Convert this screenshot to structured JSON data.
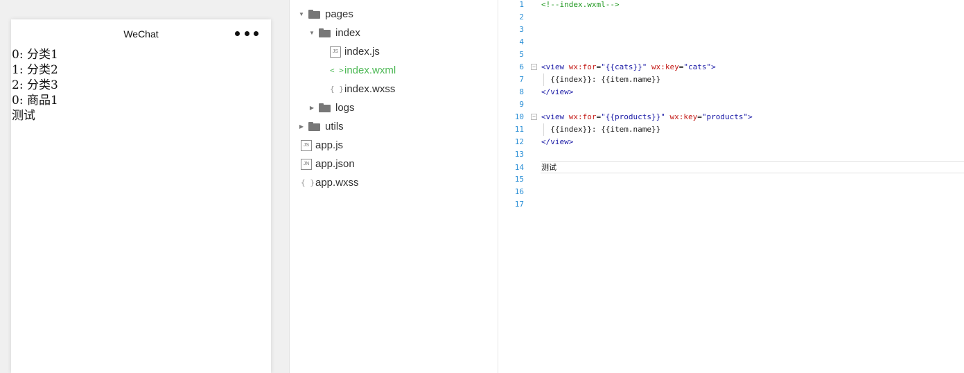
{
  "simulator": {
    "title": "WeChat",
    "lines": [
      "0: 分类1",
      "1: 分类2",
      "2: 分类3",
      "0: 商品1",
      "测试"
    ]
  },
  "file_tree": {
    "items": [
      {
        "label": "pages",
        "type": "folder",
        "expanded": true,
        "icon": "folder-open-icon"
      },
      {
        "label": "index",
        "type": "folder",
        "expanded": true,
        "icon": "folder-open-icon"
      },
      {
        "label": "index.js",
        "type": "file",
        "icon_text": "JS",
        "icon": "js-file-icon"
      },
      {
        "label": "index.wxml",
        "type": "file",
        "icon_text": "< >",
        "icon": "wxml-file-icon",
        "active": true
      },
      {
        "label": "index.wxss",
        "type": "file",
        "icon_text": "{ }",
        "icon": "wxss-file-icon"
      },
      {
        "label": "logs",
        "type": "folder",
        "expanded": false,
        "icon": "folder-icon"
      },
      {
        "label": "utils",
        "type": "folder",
        "expanded": false,
        "icon": "folder-icon"
      },
      {
        "label": "app.js",
        "type": "file",
        "icon_text": "JS",
        "icon": "js-file-icon"
      },
      {
        "label": "app.json",
        "type": "file",
        "icon_text": "JN",
        "icon": "json-file-icon"
      },
      {
        "label": "app.wxss",
        "type": "file",
        "icon_text": "{ }",
        "icon": "wxss-file-icon"
      }
    ]
  },
  "editor": {
    "active_line": 14,
    "lines": [
      {
        "n": "1",
        "text": "<!--index.wxml-->"
      },
      {
        "n": "2",
        "text": ""
      },
      {
        "n": "3",
        "text": ""
      },
      {
        "n": "4",
        "text": ""
      },
      {
        "n": "5",
        "text": ""
      },
      {
        "n": "6",
        "text": "<view wx:for=\"{{cats}}\" wx:key=\"cats\">"
      },
      {
        "n": "7",
        "text": "  {{index}}: {{item.name}}"
      },
      {
        "n": "8",
        "text": "</view>"
      },
      {
        "n": "9",
        "text": ""
      },
      {
        "n": "10",
        "text": "<view wx:for=\"{{products}}\" wx:key=\"products\">"
      },
      {
        "n": "11",
        "text": "  {{index}}: {{item.name}}"
      },
      {
        "n": "12",
        "text": "</view>"
      },
      {
        "n": "13",
        "text": ""
      },
      {
        "n": "14",
        "text": "测试"
      },
      {
        "n": "15",
        "text": ""
      },
      {
        "n": "16",
        "text": ""
      },
      {
        "n": "17",
        "text": ""
      }
    ]
  },
  "colors": {
    "active_file": "#4fb957",
    "line_number": "#2a8fd6",
    "comment": "#229922",
    "tag": "#1a1aa6",
    "attr": "#c41a16"
  }
}
